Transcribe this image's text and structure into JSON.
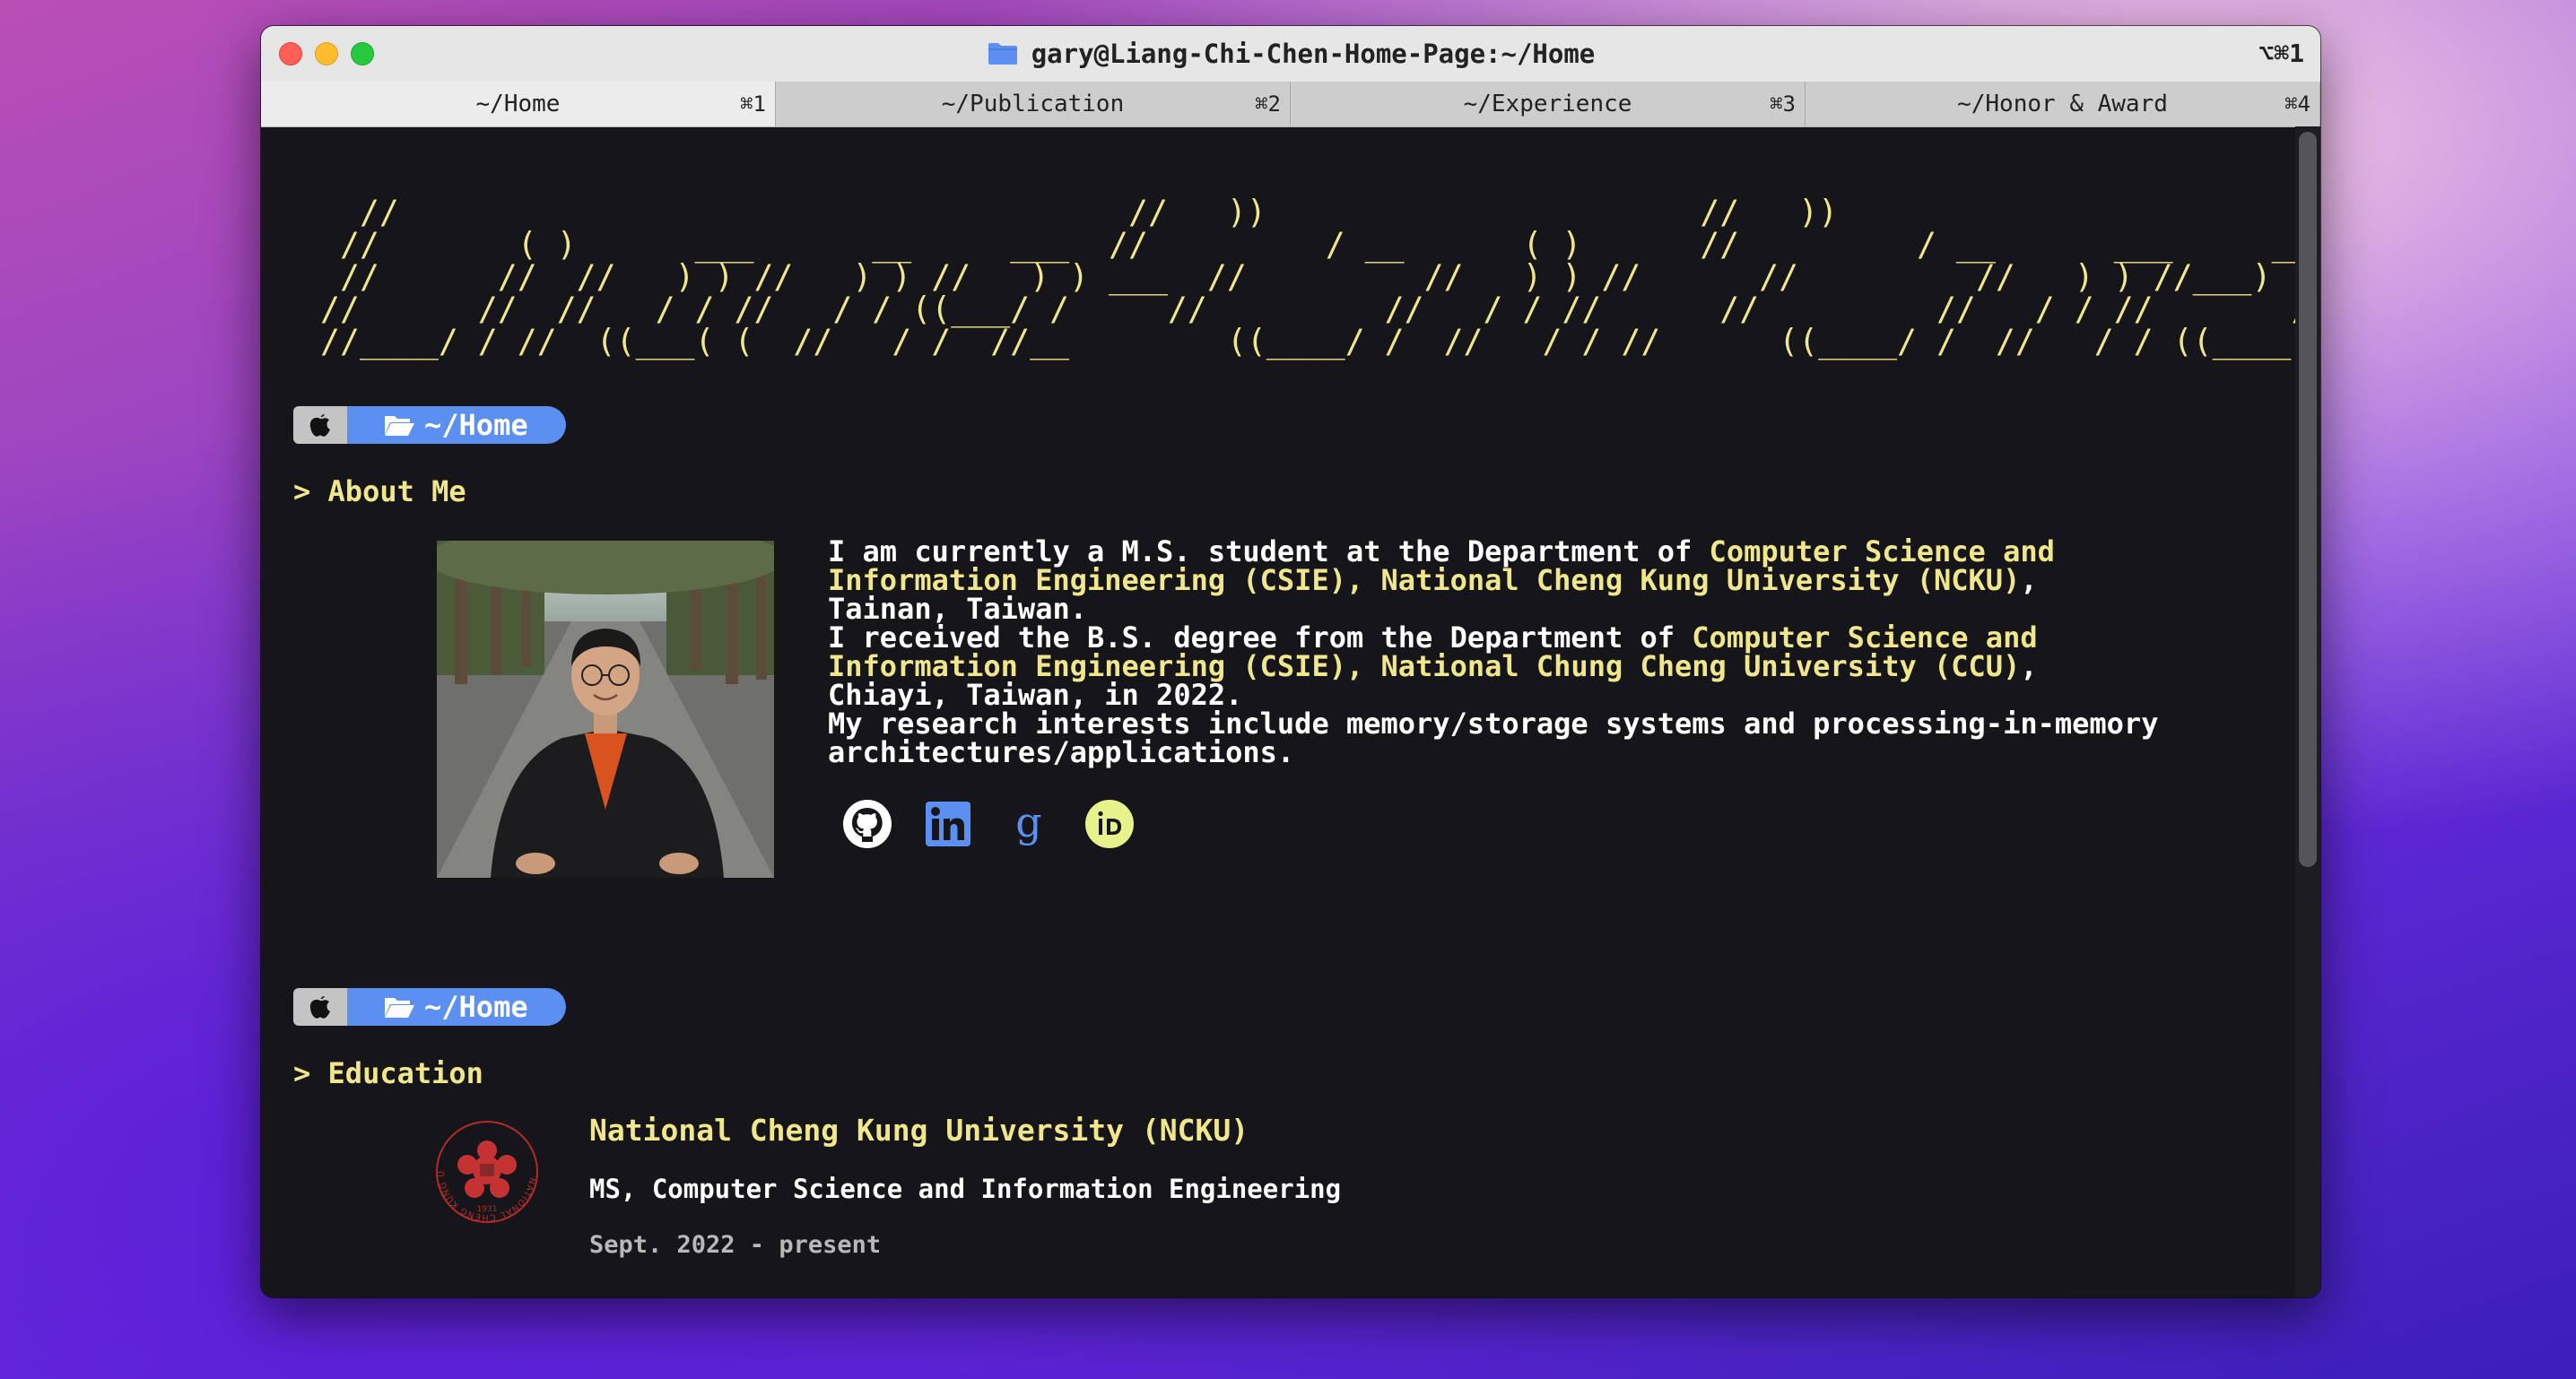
{
  "window": {
    "title": "gary@Liang-Chi-Chen-Home-Page:~/Home",
    "shortcut": "⌥⌘1"
  },
  "tabs": [
    {
      "label": "~/Home",
      "key": "⌘1",
      "active": true
    },
    {
      "label": "~/Publication",
      "key": "⌘2",
      "active": false
    },
    {
      "label": "~/Experience",
      "key": "⌘3",
      "active": false
    },
    {
      "label": "~/Honor & Award",
      "key": "⌘4",
      "active": false
    }
  ],
  "banner": {
    "lines": [
      "  //                                     //   ))                      //   ))                      ",
      " //       ( )      ___      __     ___  //         / __      ( )      //         / __      ___     __  ",
      " //      //  //   ) ) //   ) ) //   ) ) ___  //         //   ) ) //      //         //   ) ) //___) ) //   ) )",
      "//      //  //   / / //   / / ((___/ /     //         //   / / //      //         //   / / //       //   / / ",
      "//____/ / //  ((___( (  //   / /  //__        ((____/ /  //   / / //      ((____/ /  //   / / ((____   //   / /  "
    ]
  },
  "about_prompt": {
    "apple_icon": "apple-icon",
    "dir": "~/Home"
  },
  "about": {
    "heading": "> About Me",
    "p1_a": "I am currently a M.S. student at the Department of ",
    "p1_hl": "Computer Science and Information Engineering (CSIE), National Cheng Kung University (NCKU)",
    "p1_b": ", Tainan, Taiwan.",
    "p2_a": "I received the B.S. degree from the Department of ",
    "p2_hl": "Computer Science and Information Engineering (CSIE), National Chung Cheng University (CCU)",
    "p2_b": ", Chiayi, Taiwan, in 2022.",
    "p3": "My research interests include memory/storage systems and processing-in-memory architectures/applications.",
    "socials": [
      "github-icon",
      "linkedin-icon",
      "google-scholar-icon",
      "orcid-icon"
    ]
  },
  "education_prompt": {
    "apple_icon": "apple-icon",
    "dir": "~/Home"
  },
  "education": {
    "heading": "> Education",
    "school": "National Cheng Kung University (NCKU)",
    "degree": "MS, Computer Science and Information Engineering",
    "date": "Sept. 2022 - present",
    "logo_text": "NATIONAL CHENG KUNG UNIVERSITY",
    "logo_year": "1931"
  },
  "colors": {
    "accent_yellow": "#f0e68c",
    "prompt_blue": "#5b8ff0",
    "terminal_bg": "#16161a"
  }
}
